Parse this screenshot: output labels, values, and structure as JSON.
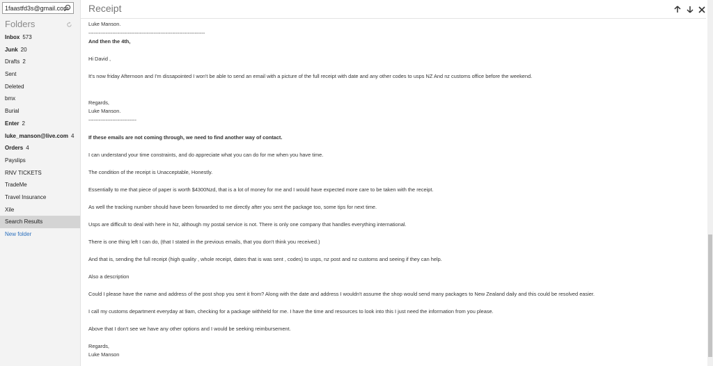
{
  "sidebar": {
    "account_email": "1faastfd3s@gmail.com",
    "folders_title": "Folders",
    "folders": [
      {
        "label": "Inbox",
        "count": "573",
        "bold": true
      },
      {
        "label": "Junk",
        "count": "20",
        "bold": true
      },
      {
        "label": "Drafts",
        "count": "2",
        "bold": false
      },
      {
        "label": "Sent",
        "count": "",
        "bold": false
      },
      {
        "label": "Deleted",
        "count": "",
        "bold": false
      },
      {
        "label": "bmx",
        "count": "",
        "bold": false
      },
      {
        "label": "Burial",
        "count": "",
        "bold": false
      },
      {
        "label": "Enter",
        "count": "2",
        "bold": true
      },
      {
        "label": "luke_manson@live.com",
        "count": "4",
        "bold": true
      },
      {
        "label": "Orders",
        "count": "4",
        "bold": true
      },
      {
        "label": "Payslips",
        "count": "",
        "bold": false
      },
      {
        "label": "RNV TICKETS",
        "count": "",
        "bold": false
      },
      {
        "label": "TradeMe",
        "count": "",
        "bold": false
      },
      {
        "label": "Travel Insurance",
        "count": "",
        "bold": false
      },
      {
        "label": "Xile",
        "count": "",
        "bold": false
      },
      {
        "label": "Search Results",
        "count": "",
        "bold": false,
        "selected": true
      }
    ],
    "new_folder_label": "New folder"
  },
  "header": {
    "title": "Receipt"
  },
  "message": {
    "lines": [
      {
        "text": "Luke Manson.",
        "bold": false
      },
      {
        "text": "--------------------------------------------------------------------",
        "bold": false
      },
      {
        "text": "And then the 4th,",
        "bold": true
      },
      {
        "text": "Hi David ,",
        "bold": false
      },
      {
        "text": "It's now friday Afternoon and I'm dissapointed I won't be able to send an email with a picture of the full receipt with date and any other codes to usps NZ And nz customs office before the weekend.",
        "bold": false
      },
      {
        "text": "Regards,",
        "bold": false
      },
      {
        "text": "Luke Manson.",
        "bold": false
      },
      {
        "text": "----------------------------",
        "bold": false
      },
      {
        "text": "If these emails are not coming through, we need to find another way of contact.",
        "bold": true
      },
      {
        "text": "I can understand your time constraints, and do appreciate what you can do for me when you have time.",
        "bold": false
      },
      {
        "text": "The condition of the receipt is Unacceptable, Honestly.",
        "bold": false
      },
      {
        "text": " Essentially to me that piece of paper is worth $4300Nzd, that is a lot of money for me and I would have expected more care to be taken with the receipt.",
        "bold": false
      },
      {
        "text": "As well the tracking number should have been forwarded to me directly after you sent the package too, some tips for next time.",
        "bold": false
      },
      {
        "text": "Usps are difficult to deal with here in Nz, although my postal service is not. There is only one company that handles everything international.",
        "bold": false
      },
      {
        "text": "There is one thing left I can do, (that I stated in the previous emails, that you don't think you received.)",
        "bold": false
      },
      {
        "text": "And that is, sending the full receipt (high quality , whole receipt, dates that is was sent , codes) to usps, nz post and nz customs and seeing if they can help.",
        "bold": false
      },
      {
        "text": "Also a description",
        "bold": false
      },
      {
        "text": "Could I please have the name and address of the post shop you sent it from? Along with the date and address I wouldn't assume the shop would send many packages to New Zealand daily and this could be resolved easier.",
        "bold": false
      },
      {
        "text": "I call my customs department everyday at 9am, checking for a package withheld for me. I have the time and resources to look into this I just need the information from you please.",
        "bold": false
      },
      {
        "text": "Above that I don't see we have any other options and I would be seeking reimbursement.",
        "bold": false
      },
      {
        "text": "Regards,",
        "bold": false
      },
      {
        "text": "Luke Manson",
        "bold": false
      }
    ]
  },
  "icons": {
    "search": "search-icon",
    "refresh": "refresh-icon",
    "up": "arrow-up-icon",
    "down": "arrow-down-icon",
    "close": "close-icon"
  }
}
